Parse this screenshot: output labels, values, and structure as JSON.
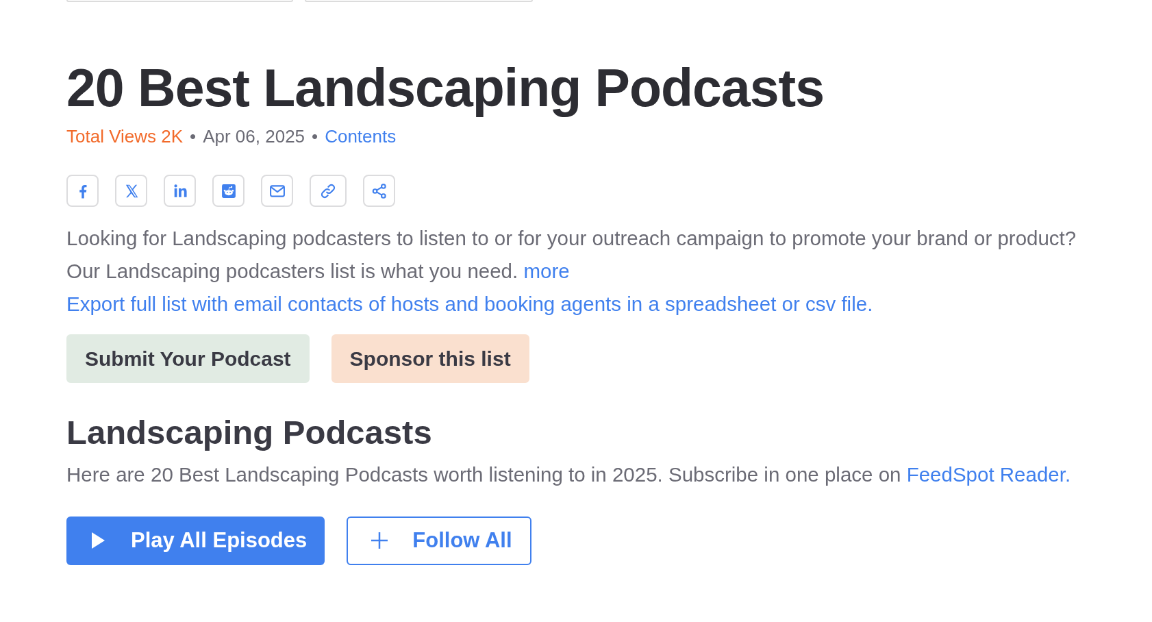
{
  "title": "20 Best Landscaping Podcasts",
  "meta": {
    "views": "Total Views 2K",
    "separator_1": "•",
    "date": "Apr 06, 2025",
    "separator_2": "•",
    "contents_link": "Contents"
  },
  "description": {
    "text": "Looking for Landscaping podcasters to listen to or for your outreach campaign to promote your brand or product? Our Landscaping podcasters list is what you need.",
    "more_link": "more"
  },
  "export_link": "Export full list with email contacts of hosts and booking agents in a spreadsheet or csv file.",
  "buttons": [
    {
      "label": "Submit Your Podcast",
      "kind": "submit"
    },
    {
      "label": "Sponsor this list",
      "kind": "sponsor"
    }
  ],
  "section": {
    "heading": "Landscaping Podcasts",
    "text": "Here are 20 Best Landscaping Podcasts worth listening to in 2025. Subscribe in one place on",
    "link": "FeedSpot Reader."
  },
  "actions": [
    {
      "label": "Play All Episodes",
      "kind": "play"
    },
    {
      "label": "Follow All",
      "kind": "follow"
    }
  ]
}
